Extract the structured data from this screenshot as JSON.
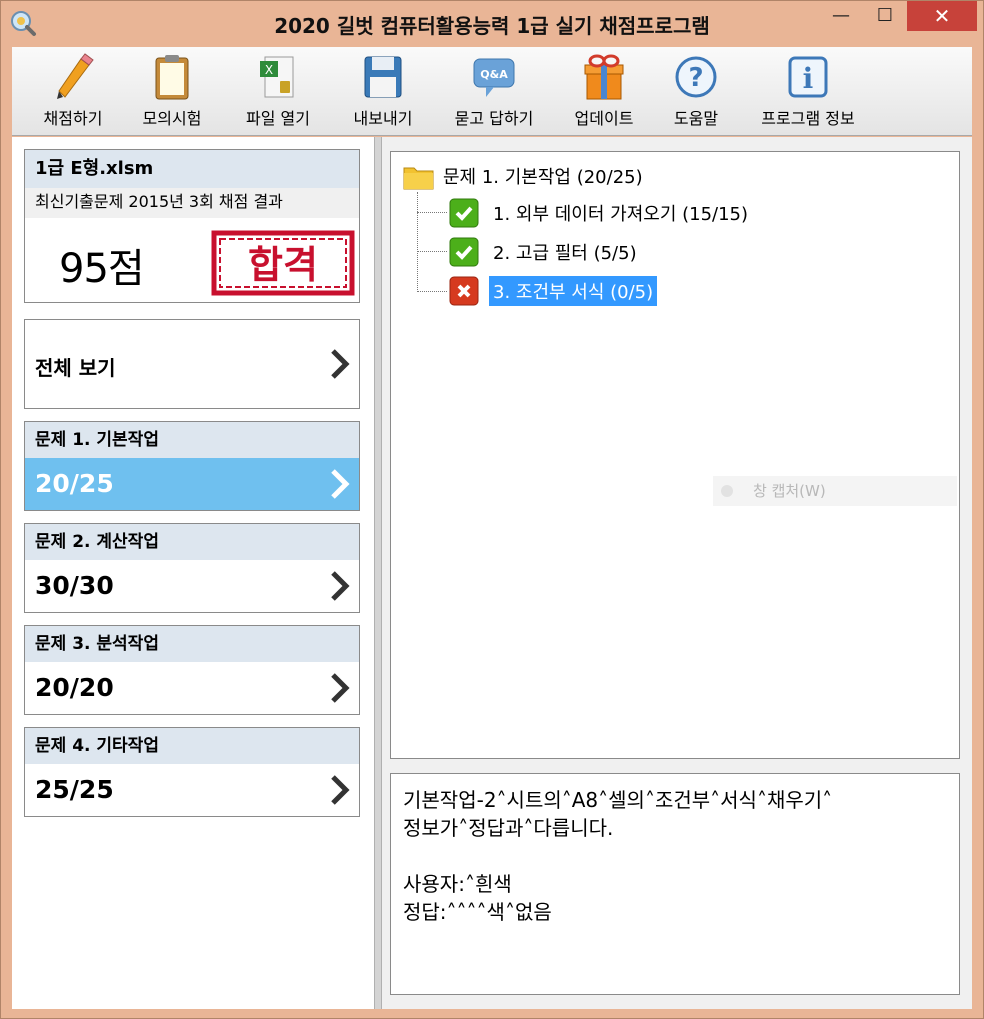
{
  "window": {
    "title": "2020 길벗 컴퓨터활용능력 1급 실기 채점프로그램",
    "minimize": "—",
    "maximize": "☐",
    "close": "✕"
  },
  "toolbar": {
    "items": [
      {
        "label": "채점하기",
        "icon": "pencil-icon"
      },
      {
        "label": "모의시험",
        "icon": "clipboard-icon"
      },
      {
        "label": "파일 열기",
        "icon": "excel-file-icon"
      },
      {
        "label": "내보내기",
        "icon": "floppy-disk-icon"
      },
      {
        "label": "묻고 답하기",
        "icon": "qa-bubble-icon"
      },
      {
        "label": "업데이트",
        "icon": "gift-icon"
      },
      {
        "label": "도움말",
        "icon": "help-icon"
      },
      {
        "label": "프로그램 정보",
        "icon": "info-icon"
      }
    ]
  },
  "result": {
    "filename": "1급 E형.xlsm",
    "subtitle": "최신기출문제 2015년 3회 채점 결과",
    "score": "95점",
    "stamp": "합격",
    "stamp_color": "#c8102e"
  },
  "overview": {
    "label": "전체 보기"
  },
  "sections": [
    {
      "title": "문제 1. 기본작업",
      "score": "20/25",
      "active": true
    },
    {
      "title": "문제 2. 계산작업",
      "score": "30/30",
      "active": false
    },
    {
      "title": "문제 3. 분석작업",
      "score": "20/20",
      "active": false
    },
    {
      "title": "문제 4. 기타작업",
      "score": "25/25",
      "active": false
    }
  ],
  "tree": {
    "root": "문제 1. 기본작업 (20/25)",
    "items": [
      {
        "label": "1. 외부 데이터 가져오기 (15/15)",
        "status": "pass"
      },
      {
        "label": "2. 고급 필터 (5/5)",
        "status": "pass"
      },
      {
        "label": "3. 조건부 서식 (0/5)",
        "status": "fail"
      }
    ]
  },
  "ghost": {
    "label": "창 캡처(W)"
  },
  "detail": {
    "line1": "기본작업-2˄시트의˄A8˄셀의˄조건부˄서식˄채우기˄",
    "line2": "정보가˄정답과˄다릅니다.",
    "line3": "사용자:˄흰색",
    "line4": "정답:˄˄˄˄색˄없음"
  },
  "colors": {
    "accent": "#6fc0ef",
    "selection": "#3399ff",
    "pass": "#4caf1a",
    "fail": "#d63a1f"
  }
}
